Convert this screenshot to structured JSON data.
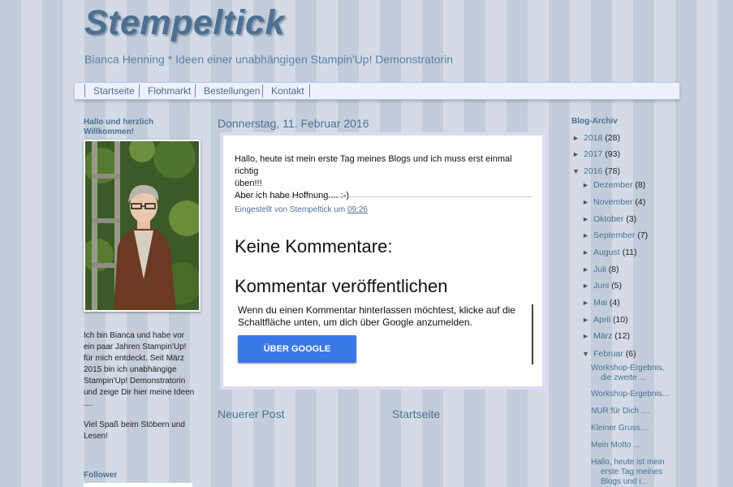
{
  "header": {
    "title": "Stempeltick",
    "description": "Bianca Henning * Ideen einer unabhängigen Stampin'Up! Demonstratorin"
  },
  "nav": {
    "tabs": [
      "Startseite",
      "Flohmarkt",
      "Bestellungen",
      "Kontakt"
    ]
  },
  "sidebar_left": {
    "welcome_title": "Hallo und herzlich Willkommen!",
    "about_lines": [
      "Ich bin Bianca und habe vor",
      "ein paar Jahren Stampin'Up!",
      "für mich entdeckt. Seit März",
      "2015 bin ich unabhängige",
      "Stampin'Up! Demonstratorin",
      "und zeige Dir hier meine Ideen",
      "...."
    ],
    "greeting_lines": [
      "Viel Spaß beim Stöbern und",
      "Lesen!"
    ],
    "follower_title": "Follower"
  },
  "post": {
    "date": "Donnerstag, 11. Februar 2016",
    "body_lines": [
      "Hallo, heute ist mein erste Tag meines Blogs und ich muss erst einmal richtig",
      "üben!!!",
      "Aber ich habe Hoffnung.... :-)"
    ],
    "footer_prefix": "Eingestellt von Stempeltick um",
    "footer_time": "09:26",
    "no_comments": "Keine Kommentare:",
    "post_comment": "Kommentar veröffentlichen",
    "comment_info": "Wenn du einen Kommentar hinterlassen möchtest, klicke auf die Schaltfläche unten, um dich über Google anzumelden.",
    "google_button": "ÜBER GOOGLE ANMELDEN"
  },
  "pager": {
    "newer": "Neuerer Post",
    "home": "Startseite"
  },
  "archive": {
    "title": "Blog-Archiv",
    "years": [
      {
        "tri": "►",
        "label": "2018",
        "count": "(28)"
      },
      {
        "tri": "►",
        "label": "2017",
        "count": "(93)"
      },
      {
        "tri": "▼",
        "label": "2016",
        "count": "(78)"
      }
    ],
    "months": [
      {
        "tri": "►",
        "label": "Dezember",
        "count": "(8)"
      },
      {
        "tri": "►",
        "label": "November",
        "count": "(4)"
      },
      {
        "tri": "►",
        "label": "Oktober",
        "count": "(3)"
      },
      {
        "tri": "►",
        "label": "September",
        "count": "(7)"
      },
      {
        "tri": "►",
        "label": "August",
        "count": "(11)"
      },
      {
        "tri": "►",
        "label": "Juli",
        "count": "(8)"
      },
      {
        "tri": "►",
        "label": "Juni",
        "count": "(5)"
      },
      {
        "tri": "►",
        "label": "Mai",
        "count": "(4)"
      },
      {
        "tri": "►",
        "label": "April",
        "count": "(10)"
      },
      {
        "tri": "►",
        "label": "März",
        "count": "(12)"
      },
      {
        "tri": "▼",
        "label": "Februar",
        "count": "(6)"
      }
    ],
    "posts": [
      [
        "Workshop-Ergebnis,",
        "die zweite ..."
      ],
      [
        "Workshop-Ergebnis..."
      ],
      [
        "NUR für Dich ...."
      ],
      [
        "Kleiner Gruss...."
      ],
      [
        "Mein Motto ..."
      ],
      [
        "Hallo, heute ist mein",
        "erste Tag meines",
        "Blogs und i..."
      ]
    ]
  }
}
